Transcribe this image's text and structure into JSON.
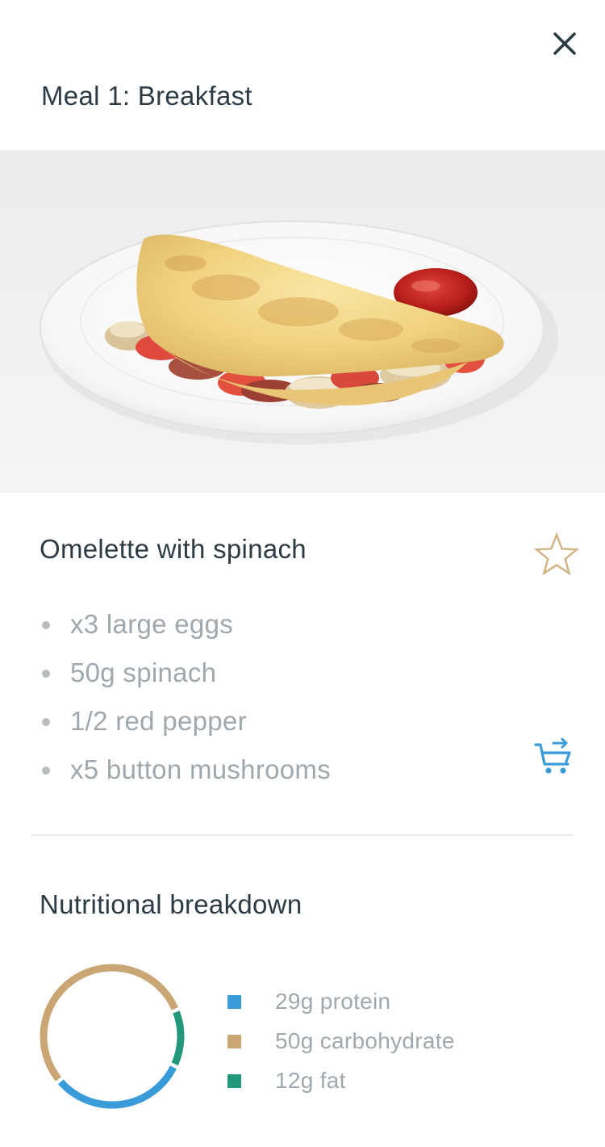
{
  "header": {
    "title": "Meal 1: Breakfast",
    "close_icon": "close-icon"
  },
  "hero": {
    "image_description_icon": "omelette-photo"
  },
  "recipe": {
    "title": "Omelette with spinach",
    "favorite_icon": "star-outline-icon",
    "favorite_color": "#d2b282",
    "cart_icon": "cart-arrow-icon",
    "cart_color": "#3a9bd9",
    "ingredients": [
      "x3 large eggs",
      "50g spinach",
      "1/2 red pepper",
      "x5 button mushrooms"
    ]
  },
  "nutrition": {
    "title": "Nutritional breakdown",
    "items": [
      {
        "label": "29g protein",
        "color": "#3a9bd9"
      },
      {
        "label": "50g carbohydrate",
        "color": "#c9a674"
      },
      {
        "label": "12g fat",
        "color": "#22977a"
      }
    ],
    "chart_data": {
      "type": "pie",
      "categories": [
        "protein",
        "carbohydrate",
        "fat"
      ],
      "values": [
        29,
        50,
        12
      ]
    }
  }
}
